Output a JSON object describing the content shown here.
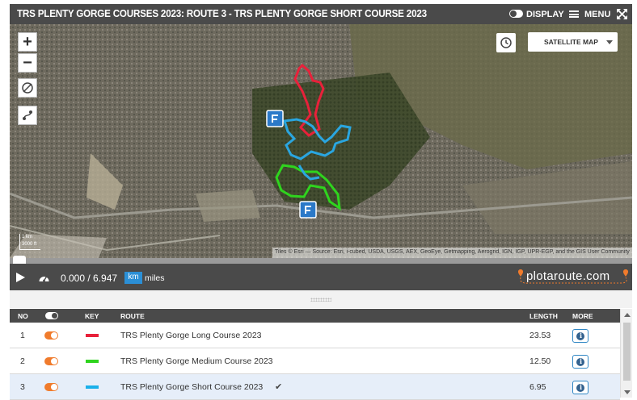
{
  "header": {
    "title": "TRS PLENTY GORGE COURSES 2023: ROUTE 3 - TRS PLENTY GORGE SHORT COURSE 2023",
    "display_label": "DISPLAY",
    "menu_label": "MENU"
  },
  "map": {
    "zoom_in": "+",
    "zoom_out": "−",
    "map_type": "SATELLITE MAP",
    "attribution": "Tiles © Esri — Source: Esri, i-cubed, USDA, USGS, AEX, GeoEye, Getmapping, Aerogrid, IGN, IGP, UPR-EGP, and the GIS User Community",
    "scale_km": "1 km",
    "scale_ft": "3000 ft",
    "colors": {
      "long": "#e8213a",
      "medium": "#2fd41e",
      "short": "#2aa6e0",
      "marker": "#2b79c8"
    }
  },
  "playback": {
    "progress": 0.0,
    "distance": "0.000 / 6.947",
    "unit_km": "km",
    "unit_miles": "miles",
    "logo": "plotaroute.com"
  },
  "table": {
    "headers": {
      "no": "NO",
      "key": "KEY",
      "route": "ROUTE",
      "length": "LENGTH",
      "more": "MORE"
    },
    "rows": [
      {
        "no": "1",
        "color": "#e8213a",
        "route": "TRS Plenty Gorge Long Course 2023",
        "length": "23.53",
        "more": "i"
      },
      {
        "no": "2",
        "color": "#2fd41e",
        "route": "TRS Plenty Gorge Medium Course 2023",
        "length": "12.50",
        "more": "i"
      },
      {
        "no": "3",
        "color": "#1ab0ea",
        "route": "TRS Plenty Gorge Short Course 2023",
        "length": "6.95",
        "more": "i",
        "check": "✔"
      }
    ]
  }
}
